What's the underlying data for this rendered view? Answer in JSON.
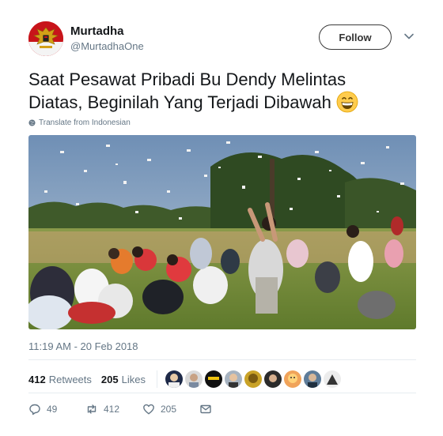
{
  "author": {
    "name": "Murtadha",
    "handle": "@MurtadhaOne"
  },
  "header": {
    "follow_label": "Follow",
    "menu_icon": "chevron-down-icon"
  },
  "tweet": {
    "text_line1": "Saat Pesawat Pribadi Bu Dendy Melintas",
    "text_line2": "Diatas, Beginilah Yang Terjadi Dibawah",
    "emoji": "grinning-face-emoji",
    "translate_label": "Translate from Indonesian",
    "timestamp": "11:19 AM - 20 Feb 2018"
  },
  "stats": {
    "retweets_count": "412",
    "retweets_label": "Retweets",
    "likes_count": "205",
    "likes_label": "Likes"
  },
  "actions": {
    "replies": "49",
    "retweets": "412",
    "likes": "205"
  },
  "colors": {
    "text": "#14171a",
    "muted": "#657786",
    "divider": "#e6ecf0"
  }
}
